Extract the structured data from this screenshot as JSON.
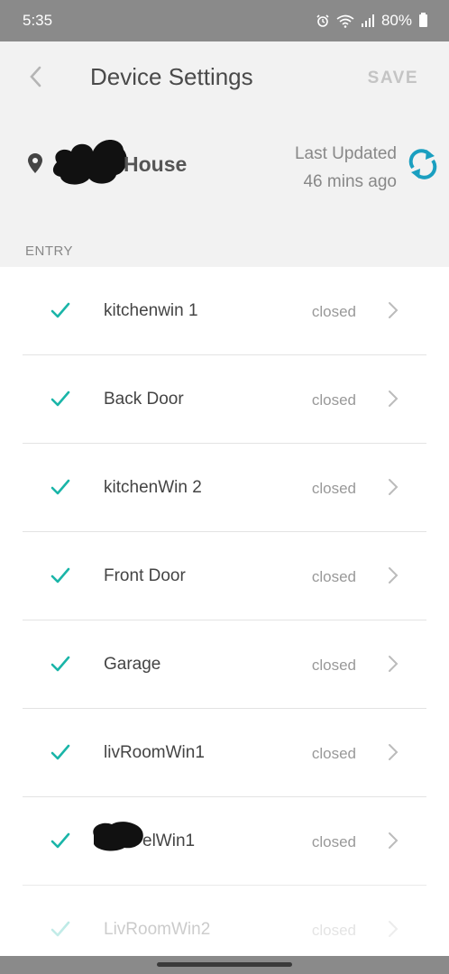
{
  "status_bar": {
    "time": "5:35",
    "battery": "80%",
    "icons": [
      "alarm-icon",
      "wifi-icon",
      "signal-icon",
      "battery-icon"
    ]
  },
  "header": {
    "title": "Device Settings",
    "save_label": "SAVE",
    "back_icon": "chevron-left-icon"
  },
  "location": {
    "name": "House",
    "last_updated_label": "Last Updated",
    "last_updated_value": "46 mins ago",
    "pin_icon": "location-pin-icon",
    "refresh_icon": "refresh-icon"
  },
  "section_label": "ENTRY",
  "devices": [
    {
      "name": "kitchenwin 1",
      "status": "closed",
      "checked": true
    },
    {
      "name": "Back Door",
      "status": "closed",
      "checked": true
    },
    {
      "name": "kitchenWin 2",
      "status": "closed",
      "checked": true
    },
    {
      "name": "Front Door",
      "status": "closed",
      "checked": true
    },
    {
      "name": "Garage",
      "status": "closed",
      "checked": true
    },
    {
      "name": "livRoomWin1",
      "status": "closed",
      "checked": true
    },
    {
      "name": "elWin1",
      "status": "closed",
      "checked": true
    },
    {
      "name": "LivRoomWin2",
      "status": "closed",
      "checked": true
    }
  ],
  "colors": {
    "accent": "#1ab5a8",
    "refresh": "#1a9fc0",
    "status_bar": "#8a8a8a"
  }
}
